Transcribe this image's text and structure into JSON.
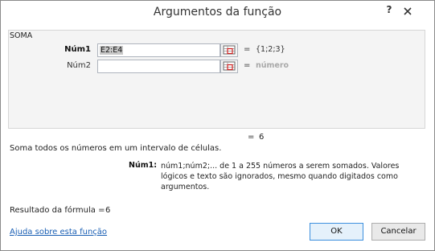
{
  "window": {
    "title": "Argumentos da função",
    "help_label": "?"
  },
  "group": {
    "label": "SOMA",
    "args": [
      {
        "label": "Núm1",
        "value": "E2:E4",
        "result": "{1;2;3}",
        "bold": true
      },
      {
        "label": "Núm2",
        "value": "",
        "result": "número",
        "bold": false
      }
    ],
    "equals_sign": "="
  },
  "total": {
    "equals": "=",
    "value": "6"
  },
  "function_description": "Soma todos os números em um intervalo de células.",
  "argument_help": {
    "name": "Núm1:",
    "text": "núm1;núm2;... de 1 a 255 números a serem somados. Valores lógicos e texto são ignorados, mesmo quando digitados como argumentos."
  },
  "formula_result": {
    "label": "Resultado da fórmula =",
    "value": "6"
  },
  "help_link": "Ajuda sobre esta função",
  "buttons": {
    "ok": "OK",
    "cancel": "Cancelar"
  }
}
